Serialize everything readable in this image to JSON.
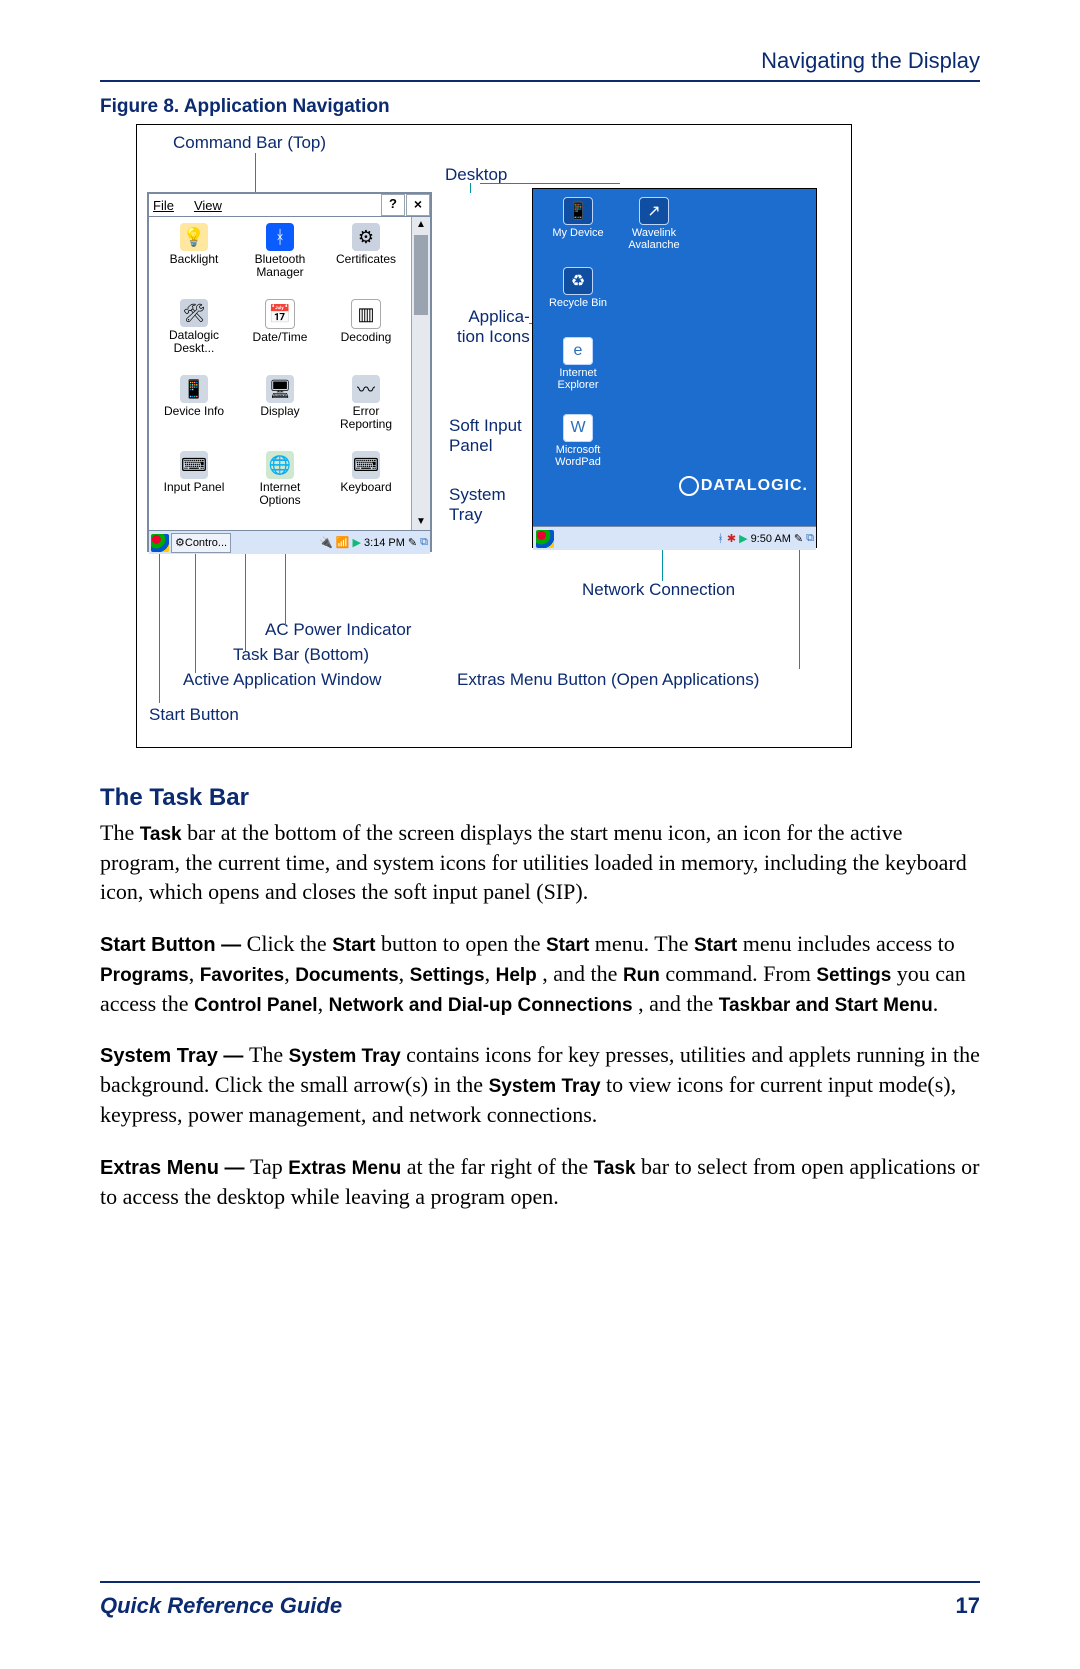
{
  "header": {
    "title": "Navigating the Display"
  },
  "figure_caption": "Figure 8. Application Navigation",
  "callouts": {
    "command_bar": "Command Bar (Top)",
    "desktop": "Desktop",
    "app_icons_l1": "Applica-",
    "app_icons_l2": "tion Icons",
    "soft_input_l1": "Soft Input",
    "soft_input_l2": "Panel",
    "system_tray_l1": "System",
    "system_tray_l2": "Tray",
    "network_conn": "Network Connection",
    "ac_power": "AC Power Indicator",
    "task_bar": "Task Bar (Bottom)",
    "active_app": "Active Application Window",
    "start_button": "Start Button",
    "extras_menu": "Extras Menu Button (Open Applications)"
  },
  "control_panel": {
    "menu_file": "File",
    "menu_view": "View",
    "help_char": "?",
    "close_char": "×",
    "icons": [
      {
        "label": "Backlight"
      },
      {
        "label": "Bluetooth\nManager"
      },
      {
        "label": "Certificates"
      },
      {
        "label": "Datalogic\nDeskt..."
      },
      {
        "label": "Date/Time"
      },
      {
        "label": "Decoding"
      },
      {
        "label": "Device Info"
      },
      {
        "label": "Display"
      },
      {
        "label": "Error\nReporting"
      },
      {
        "label": "Input Panel"
      },
      {
        "label": "Internet\nOptions"
      },
      {
        "label": "Keyboard"
      }
    ],
    "task_app": "Contro...",
    "task_time": "3:14 PM"
  },
  "desktop": {
    "items": [
      {
        "label": "My Device"
      },
      {
        "label": "Wavelink\nAvalanche"
      },
      {
        "label": "Recycle Bin"
      },
      {
        "label": "Internet\nExplorer"
      },
      {
        "label": "Microsoft\nWordPad"
      }
    ],
    "brand": "DATALOGIC.",
    "task_time": "9:50 AM"
  },
  "section_heading": "The Task Bar",
  "paragraphs": {
    "p1": "The Task bar at the bottom of the screen displays the start menu icon, an icon for the active program, the current time, and system icons for utilities loaded in memory, including the keyboard icon, which opens and closes the soft input panel (SIP).",
    "p2_lead": "Start Button — ",
    "p2_a": "Click the ",
    "p2_start": "Start",
    "p2_b": " button to open the ",
    "p2_c": " menu. The ",
    "p2_d": " menu includes access to ",
    "p2_programs": "Programs",
    "p2_favorites": "Favorites",
    "p2_documents": "Documents",
    "p2_settings": "Settings",
    "p2_help": "Help",
    "p2_and": ", and the ",
    "p2_run": "Run",
    "p2_e": " command. From ",
    "p2_f": " you can access the ",
    "p2_cp": "Control Panel",
    "p2_nd": "Network and Dial-up Connections",
    "p2_g": ", and the ",
    "p2_tsm": "Taskbar and Start Menu",
    "p2_period": ".",
    "p3_lead": "System Tray — ",
    "p3_a": "The ",
    "p3_st": "System Tray",
    "p3_b": " contains icons for key presses, utilities and applets running in the background. Click the small arrow(s) in the ",
    "p3_c": " to view icons for current input mode(s), keypress, power management, and network connections.",
    "p4_lead": "Extras Menu — ",
    "p4_a": "Tap ",
    "p4_em": "Extras Menu",
    "p4_b": " at the far right of the ",
    "p4_task": "Task",
    "p4_c": " bar to select from open applications or to access the desktop while leaving a program open."
  },
  "footer": {
    "left": "Quick Reference Guide",
    "page": "17"
  }
}
